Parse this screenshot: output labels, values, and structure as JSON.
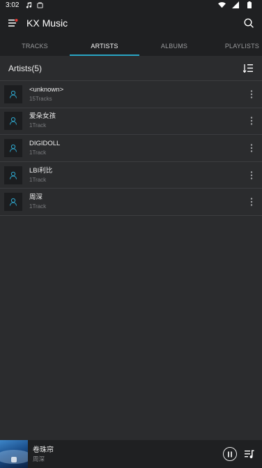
{
  "status_bar": {
    "time": "3:02",
    "icons": [
      "music-note-icon",
      "notification-icon",
      "wifi-icon",
      "cellular-signal-icon",
      "battery-icon"
    ]
  },
  "app_bar": {
    "title": "KX Music",
    "menu_icon": "menu-icon",
    "search_icon": "search-icon",
    "notification_dot_color": "#e53935"
  },
  "tabs": [
    {
      "label": "TRACKS",
      "active": false
    },
    {
      "label": "ARTISTS",
      "active": true
    },
    {
      "label": "ALBUMS",
      "active": false
    },
    {
      "label": "PLAYLISTS",
      "active": false
    }
  ],
  "section": {
    "label": "Artists(5)",
    "sort_icon": "sort-icon"
  },
  "artists": [
    {
      "name": "<unknown>",
      "count": "15Tracks"
    },
    {
      "name": "爱朵女孩",
      "count": "1Track"
    },
    {
      "name": "DIGIDOLL",
      "count": "1Track"
    },
    {
      "name": "LBI利比",
      "count": "1Track"
    },
    {
      "name": "周深",
      "count": "1Track"
    }
  ],
  "now_playing": {
    "song": "卷珠帘",
    "artist": "周深",
    "pause_icon": "pause-icon",
    "queue_icon": "queue-icon"
  },
  "colors": {
    "accent": "#29a5c4",
    "background": "#2b2c2e",
    "bar": "#1f2022"
  }
}
